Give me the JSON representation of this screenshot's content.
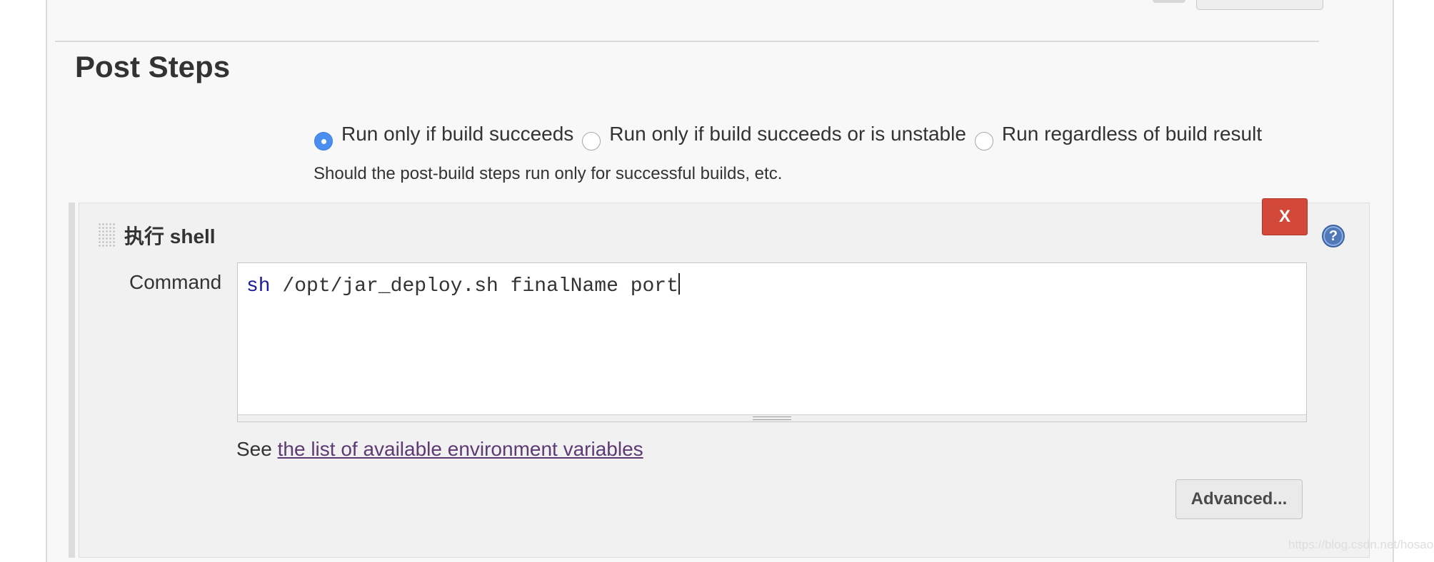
{
  "section": {
    "title": "Post Steps"
  },
  "run_condition": {
    "options": [
      {
        "label": "Run only if build succeeds",
        "checked": true
      },
      {
        "label": "Run only if build succeeds or is unstable",
        "checked": false
      },
      {
        "label": "Run regardless of build result",
        "checked": false
      }
    ],
    "description": "Should the post-build steps run only for successful builds, etc."
  },
  "build_step": {
    "title": "执行 shell",
    "delete_label": "X",
    "help_label": "?",
    "command_label": "Command",
    "command_keyword": "sh",
    "command_rest": " /opt/jar_deploy.sh finalName port",
    "env_prefix": "See ",
    "env_link": "the list of available environment variables",
    "advanced_label": "Advanced..."
  },
  "watermark": "https://blog.csdn.net/hosaos",
  "colors": {
    "radio_checked": "#4a8ff0",
    "delete_button": "#d24939",
    "link": "#5d3a73",
    "help_icon": "#5178b8"
  }
}
